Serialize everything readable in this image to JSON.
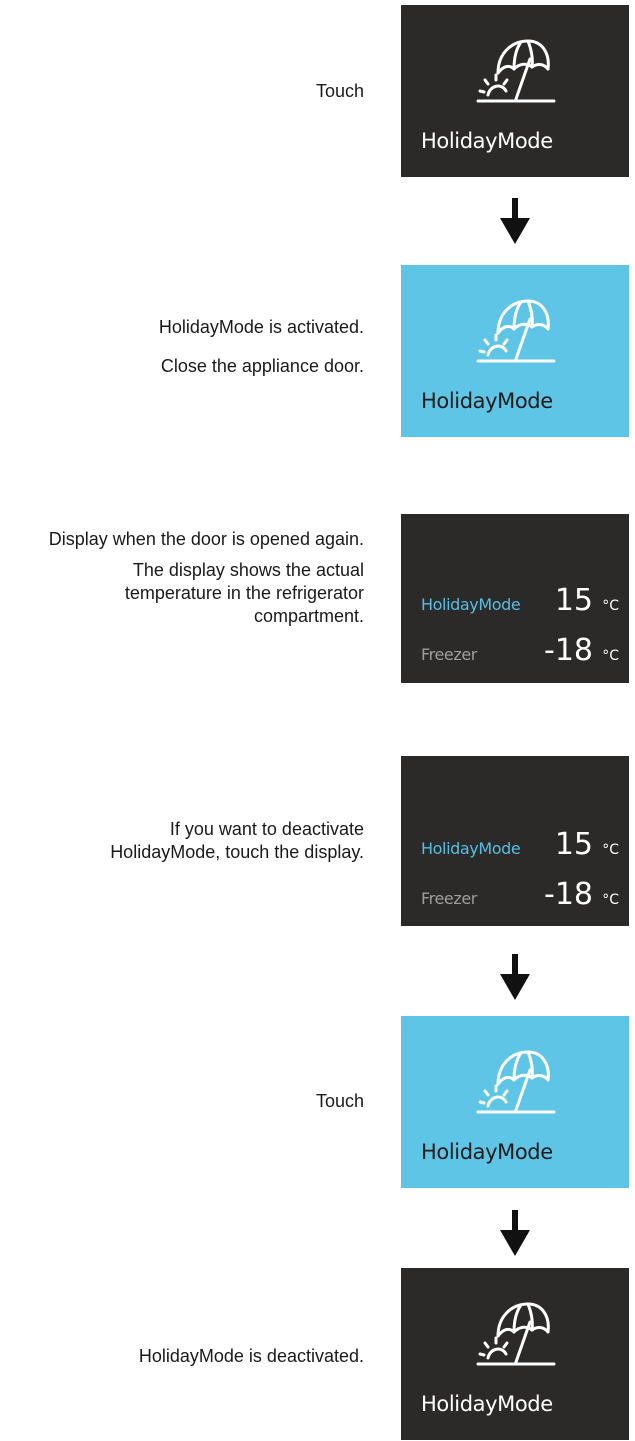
{
  "colors": {
    "panel_dark": "#2b2a29",
    "panel_blue": "#5ec5e6",
    "accent": "#57bde2",
    "muted": "#a09e9c"
  },
  "icons": {
    "mode": "umbrella-sun-icon",
    "arrow": "arrow-down-icon"
  },
  "steps": [
    {
      "instruction": [
        "Touch"
      ],
      "panel": {
        "name": "HolidayMode"
      }
    },
    {
      "instruction": [
        "HolidayMode is activated.",
        "Close the appliance door."
      ],
      "panel": {
        "name": "HolidayMode"
      }
    },
    {
      "instruction": [
        "Display when the door is opened again.",
        "The display shows the actual temperature in the refrigerator compartment."
      ],
      "panel": {
        "mode_label": "HolidayMode",
        "mode_temp": "15",
        "freezer_label": "Freezer",
        "freezer_temp": "-18",
        "unit": "°C"
      }
    },
    {
      "instruction": [
        "If you want to deactivate HolidayMode, touch the display."
      ],
      "panel": {
        "mode_label": "HolidayMode",
        "mode_temp": "15",
        "freezer_label": "Freezer",
        "freezer_temp": "-18",
        "unit": "°C"
      }
    },
    {
      "instruction": [
        "Touch"
      ],
      "panel": {
        "name": "HolidayMode"
      }
    },
    {
      "instruction": [
        "HolidayMode is deactivated."
      ],
      "panel": {
        "name": "HolidayMode"
      }
    }
  ]
}
